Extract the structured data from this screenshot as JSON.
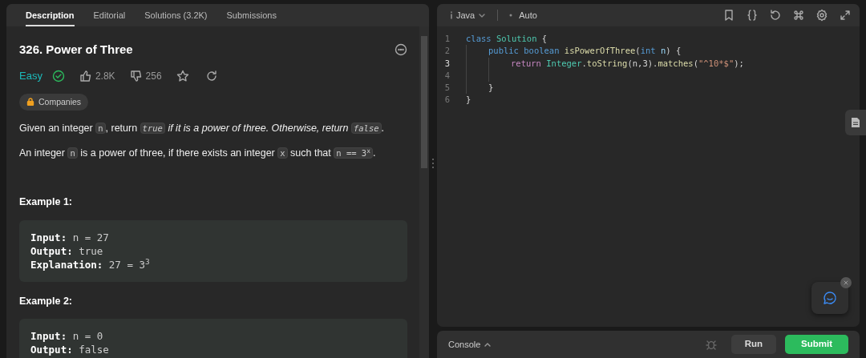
{
  "left_tabs": [
    {
      "label": "Description",
      "selected": true
    },
    {
      "label": "Editorial",
      "selected": false
    },
    {
      "label": "Solutions (3.2K)",
      "selected": false
    },
    {
      "label": "Submissions",
      "selected": false
    }
  ],
  "problem": {
    "title": "326. Power of Three",
    "difficulty": "Easy",
    "solved": true,
    "likes": "2.8K",
    "dislikes": "256",
    "tag": "Companies",
    "paragraphs": [
      [
        {
          "kind": "text",
          "text": "Given an integer "
        },
        {
          "kind": "code",
          "text": "n"
        },
        {
          "kind": "text",
          "text": ", return "
        },
        {
          "kind": "code_italic",
          "text": "true"
        },
        {
          "kind": "italic",
          "text": " if it is a power of three. Otherwise, return "
        },
        {
          "kind": "code_italic",
          "text": "false"
        },
        {
          "kind": "text",
          "text": "."
        }
      ],
      [
        {
          "kind": "text",
          "text": "An integer "
        },
        {
          "kind": "code",
          "text": "n"
        },
        {
          "kind": "text",
          "text": " is a power of three, if there exists an integer "
        },
        {
          "kind": "code",
          "text": "x"
        },
        {
          "kind": "text",
          "text": " such that "
        },
        {
          "kind": "code",
          "text": "n == 3$^{x}$"
        },
        {
          "kind": "text",
          "text": "."
        }
      ]
    ],
    "examples": [
      {
        "heading": "Example 1:",
        "lines": [
          {
            "label": "Input:",
            "value": "n = 27"
          },
          {
            "label": "Output:",
            "value": "true"
          },
          {
            "label": "Explanation:",
            "value": "27 = 3$^{3}$"
          }
        ]
      },
      {
        "heading": "Example 2:",
        "lines": [
          {
            "label": "Input:",
            "value": "n = 0"
          },
          {
            "label": "Output:",
            "value": "false"
          }
        ]
      }
    ]
  },
  "editor": {
    "language": "Java",
    "mode": "Auto",
    "lines": [
      {
        "number": "1",
        "active": false,
        "tokens": [
          {
            "kind": "keyword",
            "text": "class "
          },
          {
            "kind": "type",
            "text": "Solution"
          },
          {
            "kind": "plain",
            "text": " {"
          }
        ],
        "children": [
          {
            "number": "2",
            "active": false,
            "tokens": [
              {
                "kind": "keyword",
                "text": "public boolean "
              },
              {
                "kind": "method",
                "text": "isPowerOfThree"
              },
              {
                "kind": "plain",
                "text": "("
              },
              {
                "kind": "keyword",
                "text": "int "
              },
              {
                "kind": "param",
                "text": "n"
              },
              {
                "kind": "plain",
                "text": ") {"
              }
            ],
            "children": [
              {
                "number": "3",
                "active": true,
                "tokens": [
                  {
                    "kind": "control",
                    "text": "return "
                  },
                  {
                    "kind": "type",
                    "text": "Integer"
                  },
                  {
                    "kind": "plain",
                    "text": "."
                  },
                  {
                    "kind": "method",
                    "text": "toString"
                  },
                  {
                    "kind": "plain",
                    "text": "(n,3)."
                  },
                  {
                    "kind": "method",
                    "text": "matches"
                  },
                  {
                    "kind": "plain",
                    "text": "("
                  },
                  {
                    "kind": "string",
                    "text": "\"^10*$\""
                  },
                  {
                    "kind": "plain",
                    "text": ");"
                  }
                ]
              },
              {
                "number": "4",
                "active": false
              }
            ]
          },
          {
            "number": "5",
            "active": false,
            "tokens": [
              {
                "kind": "plain",
                "text": "}"
              }
            ]
          }
        ]
      },
      {
        "number": "6",
        "active": false,
        "tokens": [
          {
            "kind": "plain",
            "text": "}"
          }
        ]
      }
    ]
  },
  "console": {
    "label": "Console",
    "buttons": [
      {
        "label": "Run",
        "kind": "secondary"
      },
      {
        "label": "Submit",
        "kind": "primary"
      }
    ]
  }
}
